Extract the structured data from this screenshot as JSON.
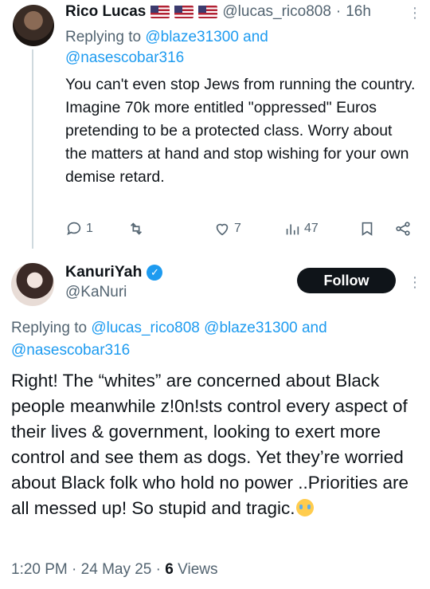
{
  "tweet1": {
    "name": "Rico Lucas",
    "flags": [
      "us-flag",
      "us-flag",
      "us-flag"
    ],
    "handle": "@lucas_rico808",
    "sep": "·",
    "time": "16h",
    "replying_prefix": "Replying to",
    "replying_to_1": "@blaze31300",
    "replying_and": "and",
    "replying_to_2": "@nasescobar316",
    "body": "You can't even stop Jews from running the country. Imagine 70k more entitled \"oppressed\" Euros pretending to be a protected class. Worry about the matters at hand and stop wishing for your own demise retard.",
    "actions": {
      "replies": "1",
      "retweets": "",
      "likes": "7",
      "views": "47"
    }
  },
  "tweet2": {
    "name": "KanuriYah",
    "verified_icon": "✓",
    "handle": "@KaNuri",
    "follow_label": "Follow",
    "replying_prefix": "Replying to",
    "replying_to_1": "@lucas_rico808",
    "replying_to_2": "@blaze31300",
    "replying_and": "and",
    "replying_to_3": "@nasescobar316",
    "body": "Right! The “whites” are concerned about Black people meanwhile z!0n!sts control every aspect of their lives & government, looking to exert more control and see them as dogs. Yet they’re worried about Black folk who hold no power ..Priorities are all messed up! So stupid and tragic.",
    "emoji": "loudly-crying-face",
    "time": "1:20 PM",
    "date": "24 May 25",
    "views_count": "6",
    "views_label": "Views"
  },
  "more_glyph": "⋮",
  "colors": {
    "accent": "#1d9bf0",
    "text": "#0f1419",
    "muted": "#536471",
    "follow_bg": "#0f1419"
  }
}
